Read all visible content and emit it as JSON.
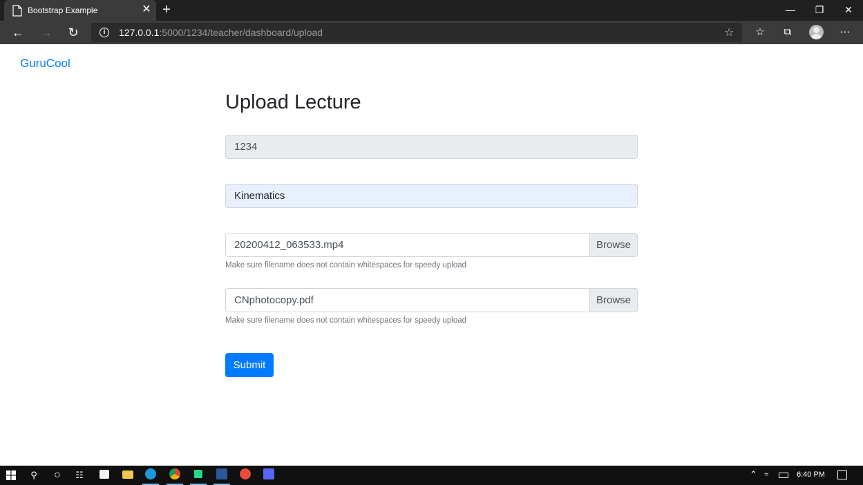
{
  "browser": {
    "tab_title": "Bootstrap Example",
    "tab_close": "✕",
    "new_tab": "+",
    "url_host": "127.0.0.1",
    "url_rest": ":5000/1234/teacher/dashboard/upload"
  },
  "page": {
    "brand": "GuruCool",
    "title": "Upload Lecture",
    "class_id_value": "1234",
    "lecture_name_value": "Kinematics",
    "video_file": {
      "filename": "20200412_063533.mp4",
      "browse_label": "Browse",
      "help": "Make sure filename does not contain whitespaces for speedy upload"
    },
    "notes_file": {
      "filename": "CNphotocopy.pdf",
      "browse_label": "Browse",
      "help": "Make sure filename does not contain whitespaces for speedy upload"
    },
    "submit_label": "Submit",
    "colors": {
      "primary": "#007bff",
      "readonly_bg": "#e9ecef",
      "autofill_bg": "#e8f0fe"
    }
  },
  "taskbar": {
    "time": "6:40 PM",
    "icons": [
      "windows-start-icon",
      "search-icon",
      "cortana-icon",
      "task-view-icon",
      "store-icon",
      "file-explorer-icon",
      "edge-icon",
      "chrome-icon",
      "pycharm-icon",
      "word-icon",
      "app-icon",
      "discord-icon"
    ]
  }
}
